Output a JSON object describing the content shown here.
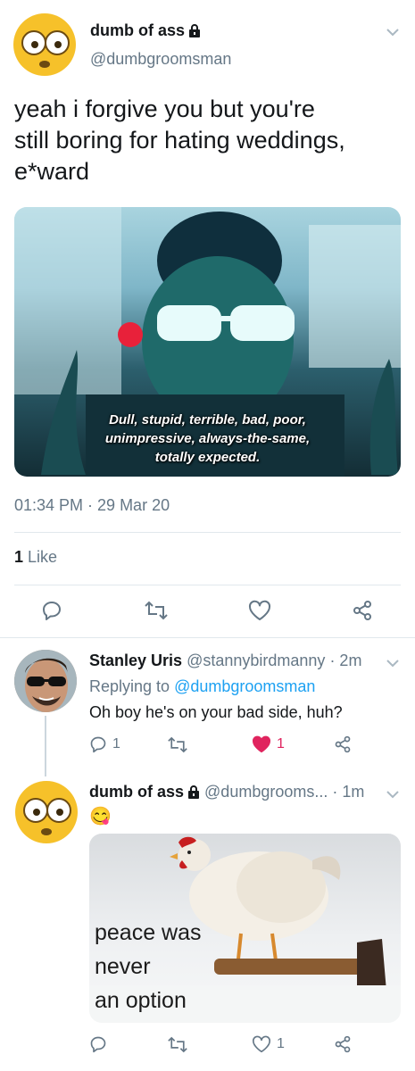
{
  "main_tweet": {
    "author_name": "dumb of ass",
    "author_handle": "@dumbgroomsman",
    "text_line1": "yeah i forgive you but you're",
    "text_line2": "still boring for hating weddings,",
    "text_line3": "e*ward",
    "image_caption_line1": "Dull, stupid, terrible, bad, poor,",
    "image_caption_line2": "unimpressive, always-the-same,",
    "image_caption_line3": "totally expected.",
    "timestamp": "01:34 PM · 29 Mar 20",
    "likes_count": "1",
    "likes_label": " Like"
  },
  "reply1": {
    "author_name": "Stanley Uris",
    "author_handle": "@stannybirdmanny",
    "time": "· 2m",
    "replying_prefix": "Replying to ",
    "replying_handle": "@dumbgroomsman",
    "text": "Oh boy he's on your bad side, huh?",
    "reply_count": "1",
    "like_count": "1"
  },
  "reply2": {
    "author_name": "dumb of ass",
    "author_handle": "@dumbgrooms...",
    "time": "· 1m",
    "emoji": "😋",
    "meme_line1": "peace was",
    "meme_line2": "never",
    "meme_line3": "an option",
    "like_count": "1"
  },
  "colors": {
    "accent": "#1da1f2",
    "like_red": "#e0245e",
    "muted": "#657786"
  },
  "icons": [
    "chevron-down-icon",
    "lock-icon",
    "reply-icon",
    "retweet-icon",
    "heart-icon",
    "share-icon"
  ]
}
